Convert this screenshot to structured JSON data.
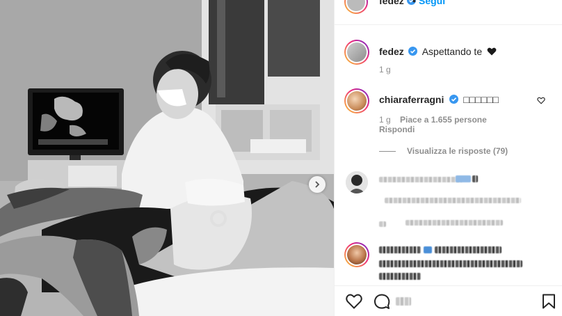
{
  "post": {
    "username": "fedez",
    "follow_label": "Segui",
    "separator": "•"
  },
  "caption": {
    "username": "fedez",
    "text": "Aspettando te",
    "time": "1 g"
  },
  "comments": [
    {
      "username": "chiaraferragni",
      "text": "□□□□□□",
      "time": "1 g",
      "likes": "Piace a 1.655 persone",
      "reply_label": "Rispondi",
      "view_replies": "Visualizza le risposte (79)"
    }
  ],
  "colors": {
    "link_blue": "#0095f6",
    "verified_blue": "#3897f0",
    "text": "#262626",
    "secondary": "#8e8e8e",
    "border": "#efefef"
  },
  "icons": {
    "verified": "verified-badge-icon",
    "black_heart": "black-heart-icon",
    "like": "heart-outline-icon",
    "comment": "comment-bubble-icon",
    "save": "bookmark-icon",
    "next": "chevron-right-icon"
  }
}
